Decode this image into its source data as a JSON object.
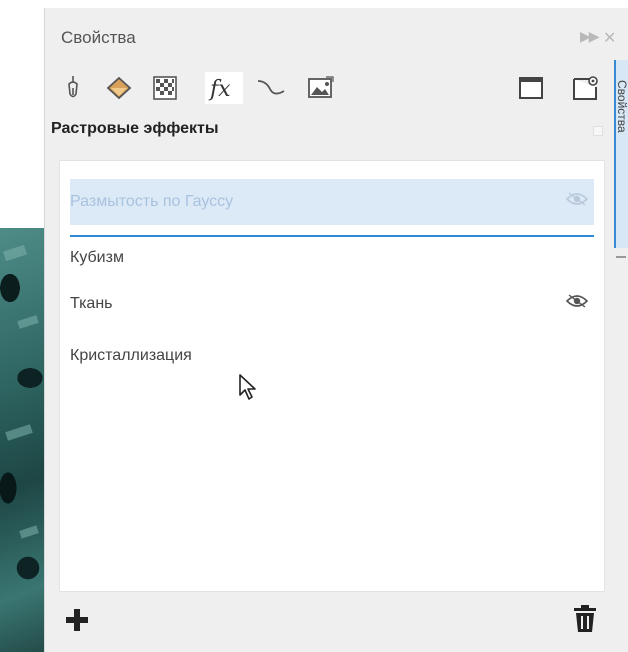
{
  "panel": {
    "title": "Свойства",
    "section_title": "Растровые эффекты",
    "toolbar_icons": [
      "pen-nib-icon",
      "fill-bucket-icon",
      "transparency-checker-icon",
      "fx-icon",
      "curve-icon",
      "image-icon"
    ],
    "toolbar_right_icons": [
      "frame-icon",
      "page-settings-icon"
    ]
  },
  "effects": [
    {
      "label": "Размытость по Гауссу",
      "state": "dragging",
      "visibility_icon": "eye-icon"
    },
    {
      "label": "Кубизм",
      "state": "normal"
    },
    {
      "label": "Ткань",
      "state": "normal",
      "visibility_icon": "eye-icon"
    },
    {
      "label": "Кристаллизация",
      "state": "normal"
    }
  ],
  "footer": {
    "add_icon": "plus-icon",
    "delete_icon": "trash-icon"
  },
  "docker_tab": {
    "label": "Свойства"
  },
  "colors": {
    "panel_bg": "#efefef",
    "selection": "#dce9f7",
    "accent": "#2f8ad6"
  }
}
